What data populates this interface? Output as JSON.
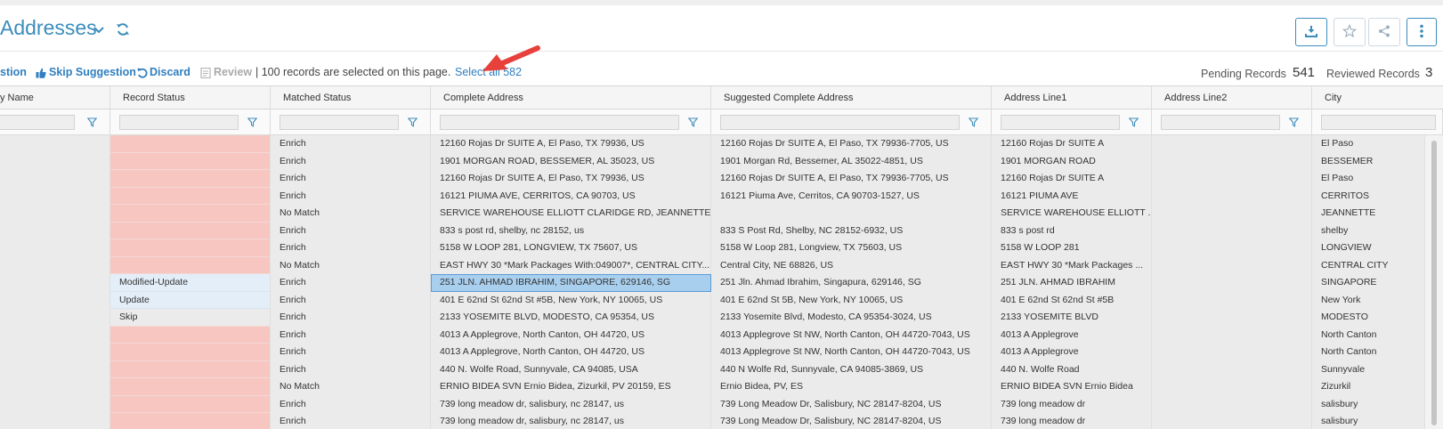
{
  "page": {
    "title": "Addresses",
    "icons": {
      "title_dropdown": "chevron-down-icon",
      "refresh": "refresh-icon",
      "download": "download-icon",
      "favorite": "star-icon",
      "share": "share-icon",
      "more": "kebab-menu-icon"
    }
  },
  "toolbar": {
    "accept_suggestion_label": "stion",
    "skip_suggestion_label": "Skip Suggestion",
    "discard_label": "Discard",
    "review_label": "Review",
    "selection_info": "| 100 records are selected on this page.",
    "select_all_label": "Select all 582",
    "pending_label": "Pending Records",
    "pending_value": "541",
    "reviewed_label": "Reviewed Records",
    "reviewed_value": "3"
  },
  "colors": {
    "accent": "#3c8dbc",
    "link": "#2f7fc0",
    "status_error": "#f7c6c1",
    "status_modified": "#e4eef8",
    "selected_cell": "#a9cfee",
    "arrow": "#e8403a"
  },
  "table": {
    "columns": [
      "y Name",
      "Record Status",
      "Matched Status",
      "Complete Address",
      "Suggested Complete Address",
      "Address Line1",
      "Address Line2",
      "City"
    ],
    "rows": [
      {
        "record_status": "",
        "matched": "Enrich",
        "address": "12160 Rojas Dr SUITE A, El Paso, TX 79936, US",
        "suggested": "12160 Rojas Dr SUITE A, El Paso, TX 79936-7705, US",
        "line1": "12160 Rojas Dr SUITE A",
        "line2": "",
        "city": "El Paso"
      },
      {
        "record_status": "",
        "matched": "Enrich",
        "address": "1901 MORGAN ROAD, BESSEMER, AL 35023, US",
        "suggested": "1901 Morgan Rd, Bessemer, AL 35022-4851, US",
        "line1": "1901 MORGAN ROAD",
        "line2": "",
        "city": "BESSEMER"
      },
      {
        "record_status": "",
        "matched": "Enrich",
        "address": "12160 Rojas Dr SUITE A, El Paso, TX 79936, US",
        "suggested": "12160 Rojas Dr SUITE A, El Paso, TX 79936-7705, US",
        "line1": "12160 Rojas Dr SUITE A",
        "line2": "",
        "city": "El Paso"
      },
      {
        "record_status": "",
        "matched": "Enrich",
        "address": "16121 PIUMA AVE, CERRITOS, CA 90703, US",
        "suggested": "16121 Piuma Ave, Cerritos, CA 90703-1527, US",
        "line1": "16121 PIUMA AVE",
        "line2": "",
        "city": "CERRITOS"
      },
      {
        "record_status": "",
        "matched": "No Match",
        "address": "SERVICE WAREHOUSE ELLIOTT CLARIDGE RD, JEANNETTE, ...",
        "suggested": "",
        "line1": "SERVICE WAREHOUSE ELLIOTT ...",
        "line2": "",
        "city": "JEANNETTE"
      },
      {
        "record_status": "",
        "matched": "Enrich",
        "address": "833 s post rd, shelby, nc 28152, us",
        "suggested": "833 S Post Rd, Shelby, NC 28152-6932, US",
        "line1": "833 s post rd",
        "line2": "",
        "city": "shelby"
      },
      {
        "record_status": "",
        "matched": "Enrich",
        "address": "5158 W LOOP 281, LONGVIEW, TX 75607, US",
        "suggested": "5158 W Loop 281, Longview, TX 75603, US",
        "line1": "5158 W LOOP 281",
        "line2": "",
        "city": "LONGVIEW"
      },
      {
        "record_status": "",
        "matched": "No Match",
        "address": "EAST HWY 30 *Mark Packages With:049007*, CENTRAL CITY...",
        "suggested": "Central City, NE 68826, US",
        "line1": "EAST HWY 30 *Mark Packages ...",
        "line2": "",
        "city": "CENTRAL CITY"
      },
      {
        "record_status": "Modified-Update",
        "matched": "Enrich",
        "address": "251 JLN. AHMAD IBRAHIM, SINGAPORE, 629146, SG",
        "suggested": "251 Jln. Ahmad Ibrahim, Singapura, 629146, SG",
        "line1": "251 JLN. AHMAD IBRAHIM",
        "line2": "",
        "city": "SINGAPORE"
      },
      {
        "record_status": "Update",
        "matched": "Enrich",
        "address": "401 E 62nd St 62nd St #5B, New York, NY 10065, US",
        "suggested": "401 E 62nd St 5B, New York, NY 10065, US",
        "line1": "401 E 62nd St 62nd St #5B",
        "line2": "",
        "city": "New York"
      },
      {
        "record_status": "Skip",
        "matched": "Enrich",
        "address": "2133 YOSEMITE BLVD, MODESTO, CA 95354, US",
        "suggested": "2133 Yosemite Blvd, Modesto, CA 95354-3024, US",
        "line1": "2133 YOSEMITE BLVD",
        "line2": "",
        "city": "MODESTO"
      },
      {
        "record_status": "",
        "matched": "Enrich",
        "address": "4013 A Applegrove, North Canton, OH 44720, US",
        "suggested": "4013 Applegrove St NW, North Canton, OH 44720-7043, US",
        "line1": "4013 A Applegrove",
        "line2": "",
        "city": "North Canton"
      },
      {
        "record_status": "",
        "matched": "Enrich",
        "address": "4013 A Applegrove, North Canton, OH 44720, US",
        "suggested": "4013 Applegrove St NW, North Canton, OH 44720-7043, US",
        "line1": "4013 A Applegrove",
        "line2": "",
        "city": "North Canton"
      },
      {
        "record_status": "",
        "matched": "Enrich",
        "address": "440 N. Wolfe Road, Sunnyvale, CA 94085, USA",
        "suggested": "440 N Wolfe Rd, Sunnyvale, CA 94085-3869, US",
        "line1": "440 N. Wolfe Road",
        "line2": "",
        "city": "Sunnyvale"
      },
      {
        "record_status": "",
        "matched": "No Match",
        "address": "ERNIO BIDEA SVN Ernio Bidea, Zizurkil, PV 20159, ES",
        "suggested": "Ernio Bidea, PV, ES",
        "line1": "ERNIO BIDEA SVN Ernio Bidea",
        "line2": "",
        "city": "Zizurkil"
      },
      {
        "record_status": "",
        "matched": "Enrich",
        "address": "739 long meadow dr, salisbury, nc 28147, us",
        "suggested": "739 Long Meadow Dr, Salisbury, NC 28147-8204, US",
        "line1": "739 long meadow dr",
        "line2": "",
        "city": "salisbury"
      },
      {
        "record_status": "",
        "matched": "Enrich",
        "address": "739 long meadow dr, salisbury, nc 28147, us",
        "suggested": "739 Long Meadow Dr, Salisbury, NC 28147-8204, US",
        "line1": "739 long meadow dr",
        "line2": "",
        "city": "salisbury"
      }
    ]
  }
}
